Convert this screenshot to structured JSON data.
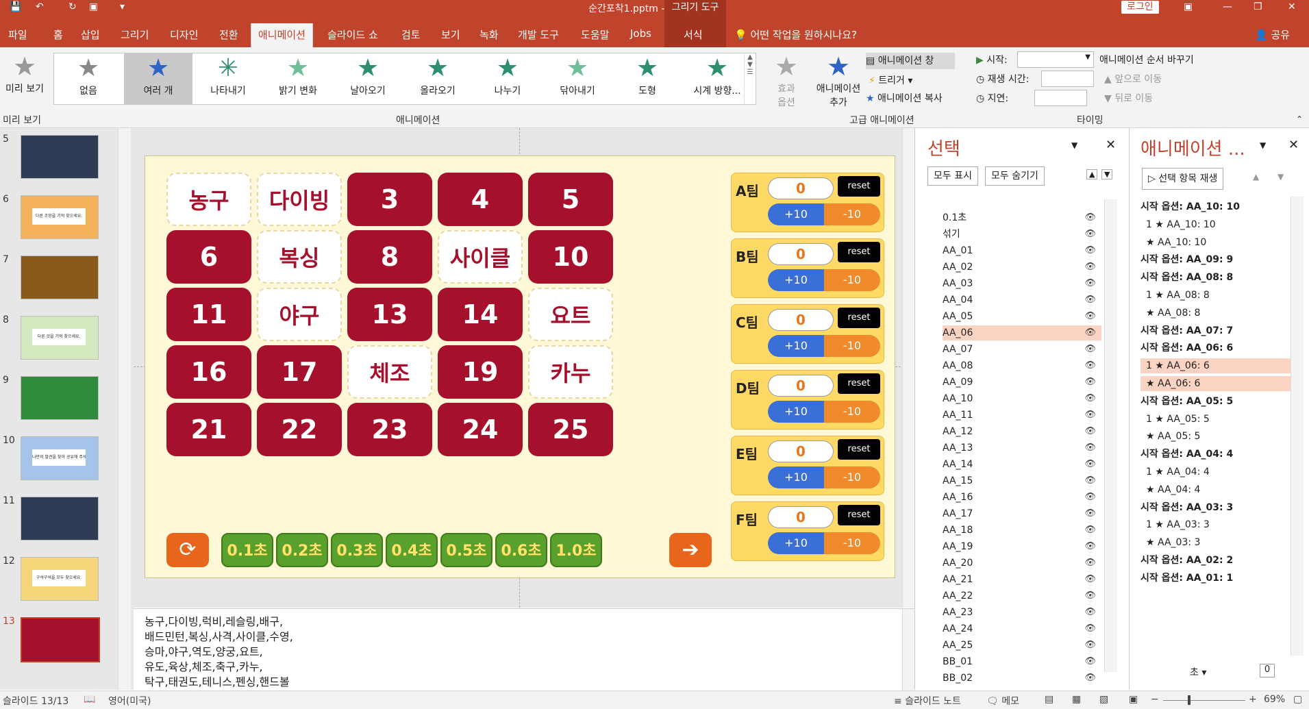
{
  "titlebar": {
    "title": "순간포착1.pptm  -  PowerPoint",
    "context_tab": "그리기 도구",
    "login": "로그인"
  },
  "tabs": [
    "파일",
    "홈",
    "삽입",
    "그리기",
    "디자인",
    "전환",
    "애니메이션",
    "슬라이드 쇼",
    "검토",
    "보기",
    "녹화",
    "개발 도구",
    "도움말",
    "Jobs"
  ],
  "active_tab": "애니메이션",
  "format_tab": "서식",
  "tell_me": "어떤 작업을 원하시나요?",
  "share": "공유",
  "ribbon": {
    "preview_label": "미리 보기",
    "preview_group": "미리 보기",
    "animations": [
      "없음",
      "여러 개",
      "나타내기",
      "밝기 변화",
      "날아오기",
      "올라오기",
      "나누기",
      "닦아내기",
      "도형",
      "시계 방향..."
    ],
    "selected_animation": "여러 개",
    "effect_options": "효과 옵션",
    "animation_group": "애니메이션",
    "add_animation": "애니메이션 추가",
    "anim_pane": "애니메이션 창",
    "trigger": "트리거",
    "anim_painter": "애니메이션 복사",
    "advanced_group": "고급 애니메이션",
    "start_label": "시작:",
    "duration_label": "재생 시간:",
    "delay_label": "지연:",
    "reorder_title": "애니메이션 순서 바꾸기",
    "move_earlier": "앞으로 이동",
    "move_later": "뒤로 이동",
    "timing_group": "타이밍"
  },
  "thumbnails": [
    {
      "num": "5",
      "color": "#2f3b55"
    },
    {
      "num": "6",
      "color": "#f2b15a",
      "caption": "다른 조망을 기억 찾으세요."
    },
    {
      "num": "7",
      "color": "#8a5a1a"
    },
    {
      "num": "8",
      "color": "#d4e8c0",
      "caption": "다른 것을 기억 찾으세요."
    },
    {
      "num": "9",
      "color": "#2e8b3a"
    },
    {
      "num": "10",
      "color": "#a6c4ea",
      "caption": "나만의 발견을 찾아 공유해 주세요."
    },
    {
      "num": "11",
      "color": "#2f3b55"
    },
    {
      "num": "12",
      "color": "#f6d67a",
      "caption": "구석구석을 모두 찾으세요."
    },
    {
      "num": "13",
      "color": "#a5102c"
    }
  ],
  "board": {
    "tiles": [
      {
        "label": "농구",
        "style": "white"
      },
      {
        "label": "다이빙",
        "style": "white"
      },
      {
        "label": "3",
        "style": "red"
      },
      {
        "label": "4",
        "style": "red"
      },
      {
        "label": "5",
        "style": "red"
      },
      {
        "label": "6",
        "style": "red"
      },
      {
        "label": "복싱",
        "style": "white"
      },
      {
        "label": "8",
        "style": "red"
      },
      {
        "label": "사이클",
        "style": "white"
      },
      {
        "label": "10",
        "style": "red"
      },
      {
        "label": "11",
        "style": "red"
      },
      {
        "label": "야구",
        "style": "white"
      },
      {
        "label": "13",
        "style": "red"
      },
      {
        "label": "14",
        "style": "red"
      },
      {
        "label": "요트",
        "style": "white"
      },
      {
        "label": "16",
        "style": "red"
      },
      {
        "label": "17",
        "style": "red"
      },
      {
        "label": "체조",
        "style": "white"
      },
      {
        "label": "19",
        "style": "red"
      },
      {
        "label": "카누",
        "style": "white"
      },
      {
        "label": "21",
        "style": "red"
      },
      {
        "label": "22",
        "style": "red"
      },
      {
        "label": "23",
        "style": "red"
      },
      {
        "label": "24",
        "style": "red"
      },
      {
        "label": "25",
        "style": "red"
      }
    ],
    "teams": [
      {
        "name": "A팀",
        "score": "0"
      },
      {
        "name": "B팀",
        "score": "0"
      },
      {
        "name": "C팀",
        "score": "0"
      },
      {
        "name": "D팀",
        "score": "0"
      },
      {
        "name": "E팀",
        "score": "0"
      },
      {
        "name": "F팀",
        "score": "0"
      }
    ],
    "reset_label": "reset",
    "plus_label": "+10",
    "minus_label": "-10",
    "time_buttons": [
      "0.1초",
      "0.2초",
      "0.3초",
      "0.4초",
      "0.5초",
      "0.6초",
      "1.0초"
    ]
  },
  "notes": [
    "농구,다이빙,럭비,레슬링,배구,",
    "배드민턴,복싱,사격,사이클,수영,",
    "승마,야구,역도,양궁,요트,",
    "유도,육상,체조,축구,카누,",
    "탁구,태권도,테니스,펜싱,핸드볼"
  ],
  "selection_pane": {
    "title": "선택",
    "show_all": "모두 표시",
    "hide_all": "모두 숨기기",
    "items": [
      "0.1초",
      "섞기",
      "AA_01",
      "AA_02",
      "AA_03",
      "AA_04",
      "AA_05",
      "AA_06",
      "AA_07",
      "AA_08",
      "AA_09",
      "AA_10",
      "AA_11",
      "AA_12",
      "AA_13",
      "AA_14",
      "AA_15",
      "AA_16",
      "AA_17",
      "AA_18",
      "AA_19",
      "AA_20",
      "AA_21",
      "AA_22",
      "AA_23",
      "AA_24",
      "AA_25",
      "BB_01",
      "BB_02"
    ],
    "selected": "AA_06"
  },
  "animation_pane": {
    "title": "애니메이션 ...",
    "play_selected": "선택 항목 재생",
    "rows": [
      {
        "text": "시작 옵션: AA_10: 10",
        "type": "head"
      },
      {
        "text": "1 ★ AA_10: 10",
        "type": "item"
      },
      {
        "text": "★ AA_10: 10",
        "type": "item"
      },
      {
        "text": "시작 옵션: AA_09: 9",
        "type": "head"
      },
      {
        "text": "시작 옵션: AA_08: 8",
        "type": "head"
      },
      {
        "text": "1 ★ AA_08: 8",
        "type": "item"
      },
      {
        "text": "★ AA_08: 8",
        "type": "item"
      },
      {
        "text": "시작 옵션: AA_07: 7",
        "type": "head"
      },
      {
        "text": "시작 옵션: AA_06: 6",
        "type": "head"
      },
      {
        "text": "1 ★ AA_06: 6",
        "type": "hl"
      },
      {
        "text": "★ AA_06: 6",
        "type": "hl"
      },
      {
        "text": "시작 옵션: AA_05: 5",
        "type": "head"
      },
      {
        "text": "1 ★ AA_05: 5",
        "type": "item"
      },
      {
        "text": "★ AA_05: 5",
        "type": "item"
      },
      {
        "text": "시작 옵션: AA_04: 4",
        "type": "head"
      },
      {
        "text": "1 ★ AA_04: 4",
        "type": "item"
      },
      {
        "text": "★ AA_04: 4",
        "type": "item"
      },
      {
        "text": "시작 옵션: AA_03: 3",
        "type": "head"
      },
      {
        "text": "1 ★ AA_03: 3",
        "type": "item"
      },
      {
        "text": "★ AA_03: 3",
        "type": "item"
      },
      {
        "text": "시작 옵션: AA_02: 2",
        "type": "head"
      },
      {
        "text": "시작 옵션: AA_01: 1",
        "type": "head"
      }
    ],
    "seconds_label": "초",
    "zoom_value": "0"
  },
  "status": {
    "slide": "슬라이드 13/13",
    "language": "영어(미국)",
    "notes_btn": "슬라이드 노트",
    "comments_btn": "메모",
    "zoom": "69%"
  }
}
